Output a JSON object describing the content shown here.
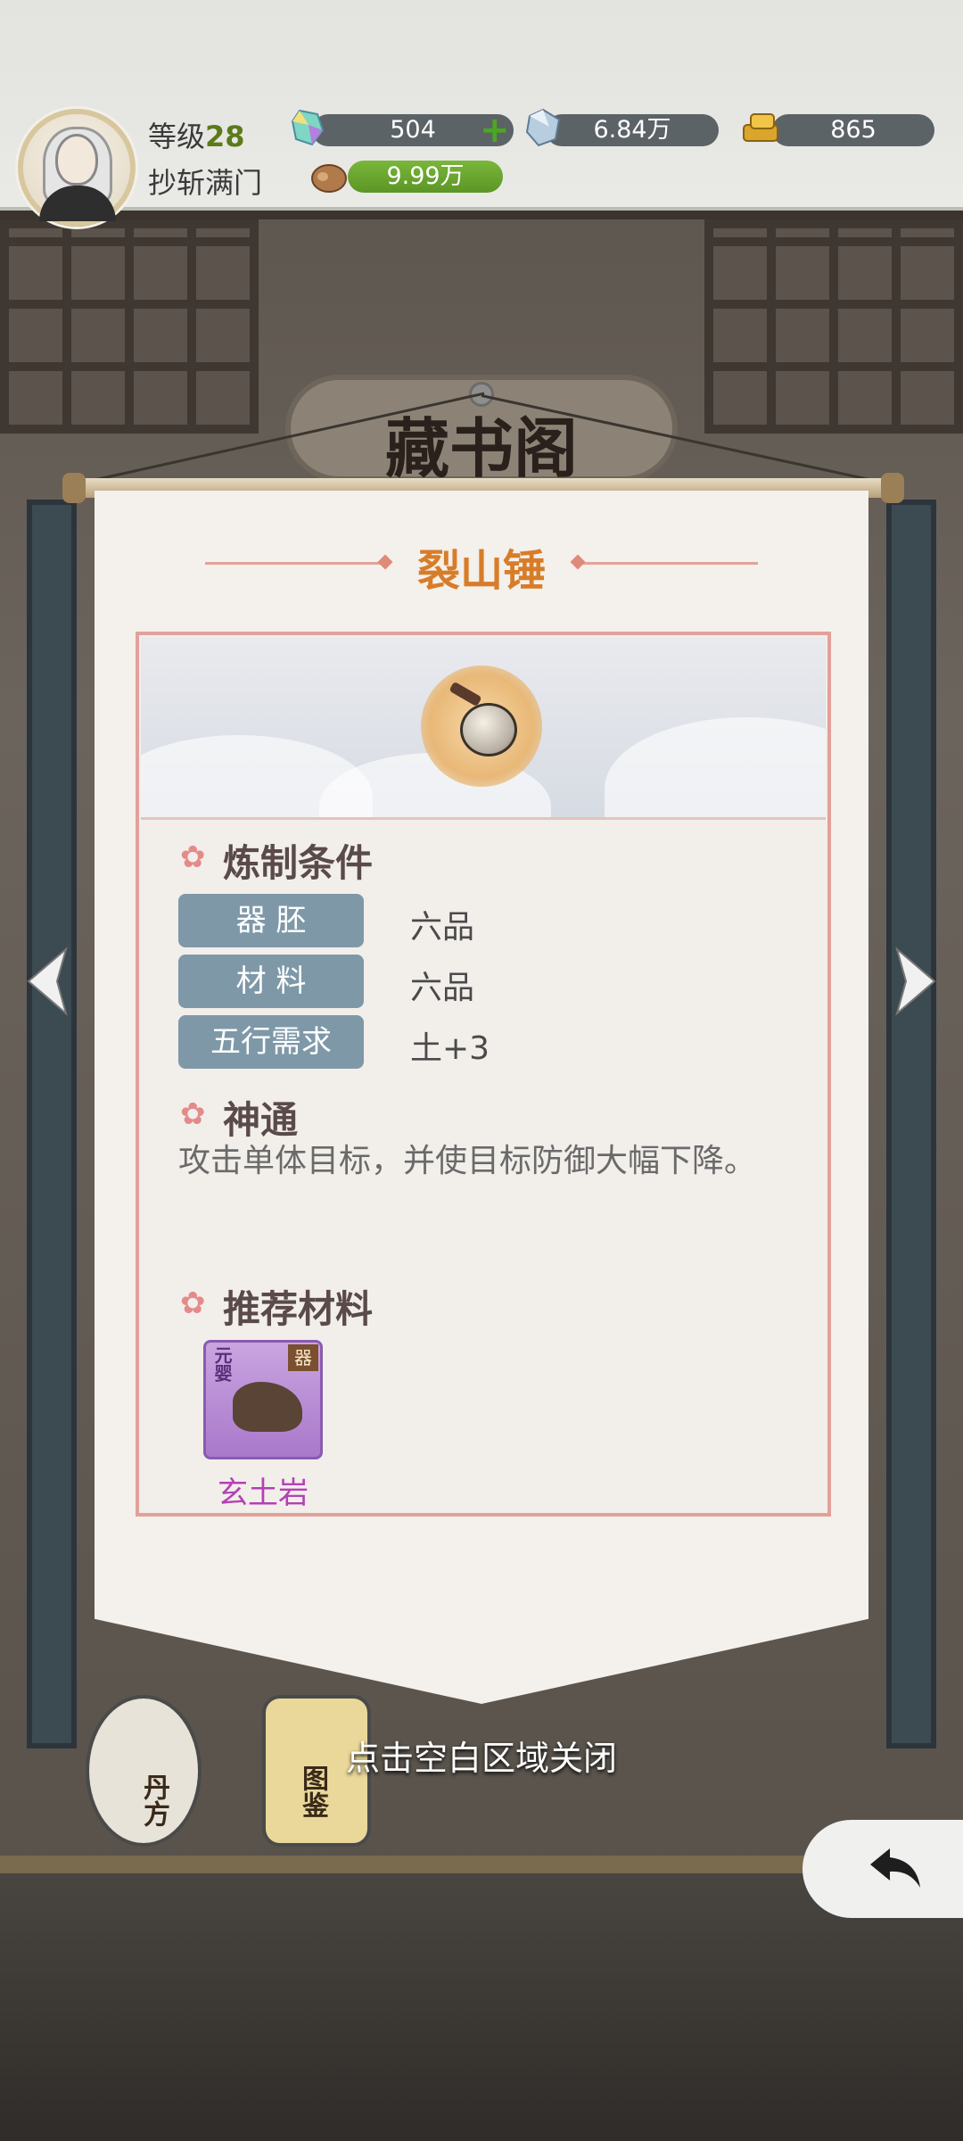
{
  "hud": {
    "level_label": "等级",
    "level_value": "28",
    "player_name": "抄斩满门",
    "resources": {
      "crystal": "504",
      "ice_gem": "6.84万",
      "gold": "865",
      "wood": "9.99万"
    }
  },
  "background": {
    "hall_sign": "藏书阁"
  },
  "panel": {
    "item_title": "裂山锤",
    "crafting": {
      "heading": "炼制条件",
      "rows": [
        {
          "tag": "器 胚",
          "value": "六品"
        },
        {
          "tag": "材 料",
          "value": "六品"
        },
        {
          "tag": "五行需求",
          "value": "土+3"
        }
      ]
    },
    "ability": {
      "heading": "神通",
      "description": "攻击单体目标，并使目标防御大幅下降。"
    },
    "recommended": {
      "heading": "推荐材料",
      "material_name": "玄土岩",
      "material_tag": "元婴",
      "material_badge": "器"
    }
  },
  "footer": {
    "close_hint": "点击空白区域关闭",
    "npc_left": "丹方",
    "npc_right": "图鉴"
  },
  "colors": {
    "title": "#d77d29",
    "tag_bg": "#7e98a8",
    "material_name": "#b341b5",
    "accent_border": "#e3a09a"
  }
}
